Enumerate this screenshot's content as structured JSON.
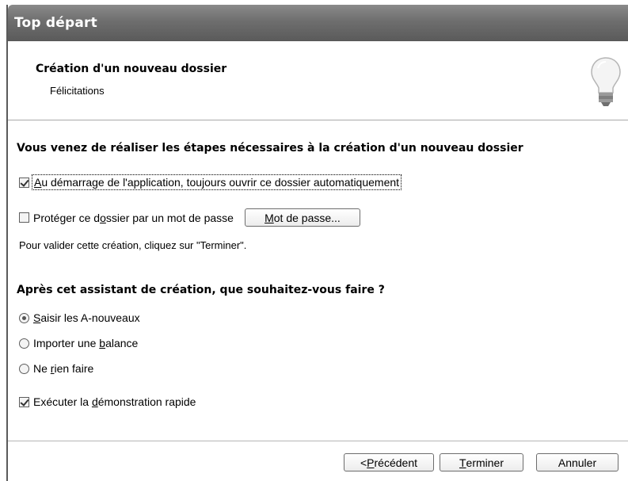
{
  "window": {
    "title": "Top départ"
  },
  "header": {
    "title": "Création d'un nouveau dossier",
    "subtitle": "Félicitations"
  },
  "content": {
    "heading1": "Vous venez de réaliser les étapes nécessaires à la création d'un nouveau dossier",
    "auto_open": {
      "checked": true,
      "accel": "A",
      "label_rest": "u démarrage de l'application, toujours ouvrir ce dossier automatiquement"
    },
    "password_protect": {
      "checked": false,
      "label_pre": "Protéger ce d",
      "accel": "o",
      "label_post": "ssier par un mot de passe",
      "button_accel": "M",
      "button_rest": "ot de passe..."
    },
    "validate_text": "Pour valider cette création, cliquez sur \"Terminer\".",
    "heading2": "Après cet assistant de création, que souhaitez-vous faire ?",
    "options": [
      {
        "pre": "",
        "accel": "S",
        "post": "aisir les A-nouveaux",
        "selected": true
      },
      {
        "pre": "Importer une ",
        "accel": "b",
        "post": "alance",
        "selected": false
      },
      {
        "pre": "Ne ",
        "accel": "r",
        "post": "ien faire",
        "selected": false
      }
    ],
    "demo": {
      "checked": true,
      "label_pre": "Exécuter la ",
      "accel": "d",
      "label_post": "émonstration rapide"
    }
  },
  "footer": {
    "back": {
      "pre": "< ",
      "accel": "P",
      "post": "récédent"
    },
    "finish": {
      "accel": "T",
      "post": "erminer"
    },
    "cancel": "Annuler"
  },
  "icons": {
    "header": "lightbulb-icon"
  },
  "colors": {
    "titlebar": "#6e6e6e",
    "title_text": "#ffffff"
  }
}
